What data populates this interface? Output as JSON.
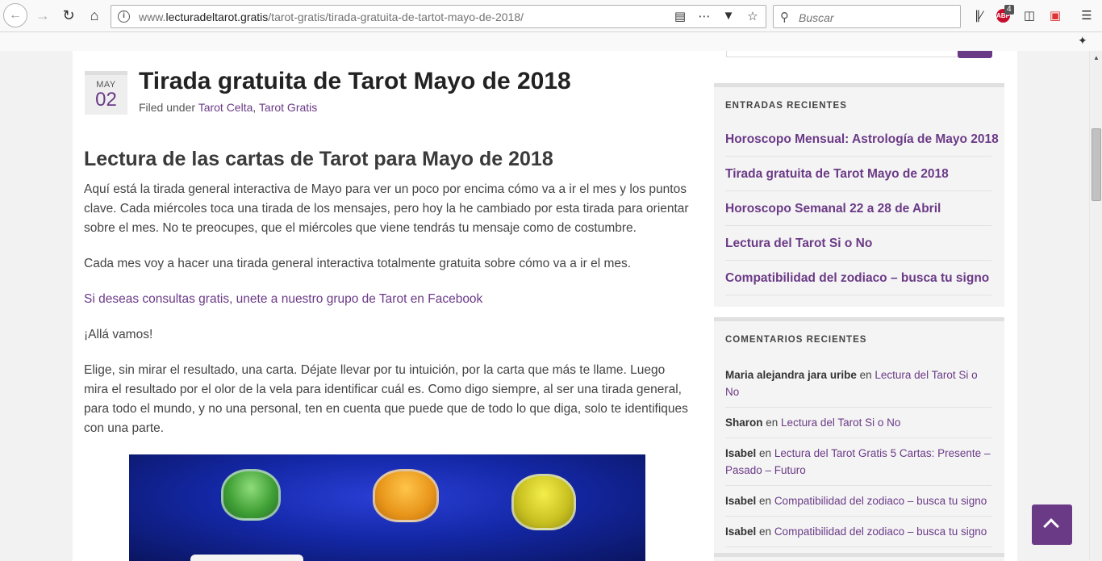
{
  "browser": {
    "url_host": "www.lecturadeltarot.gratis",
    "url_path": "/tarot-gratis/tirada-gratuita-de-tartot-mayo-de-2018/",
    "url_prefix": "www.",
    "url_domain": "lecturadeltarot.gratis",
    "search_placeholder": "Buscar",
    "abp_label": "ABP",
    "abp_count": "4"
  },
  "post": {
    "date_month": "MAY",
    "date_day": "02",
    "title": "Tirada gratuita de Tarot Mayo de 2018",
    "filed_prefix": "Filed under ",
    "categories": [
      "Tarot Celta",
      "Tarot Gratis"
    ],
    "category_separator": ", ",
    "subheading": "Lectura de las cartas de Tarot para Mayo de 2018",
    "paragraphs": [
      "Aquí está la tirada general interactiva de Mayo para ver un poco por encima cómo va a ir el mes y los puntos clave. Cada miércoles toca una tirada de los mensajes, pero hoy la he cambiado por esta tirada para orientar sobre el mes. No te preocupes, que el miércoles que viene tendrás tu mensaje como de costumbre.",
      "Cada mes voy a hacer una tirada general interactiva totalmente gratuita sobre cómo va a ir el mes.",
      "Si deseas consultas gratis, unete a nuestro grupo de Tarot en Facebook",
      "¡Allá vamos!",
      "Elige, sin mirar el resultado, una carta. Déjate llevar por tu intuición, por la carta que más te llame. Luego mira el resultado por el olor de la vela para identificar cuál es. Como digo siempre, al ser una tirada general, para todo el mundo, y no una personal, ten en cuenta que puede que de todo lo que diga, solo te identifiques con una parte."
    ]
  },
  "sidebar": {
    "recent_title": "ENTRADAS RECIENTES",
    "recent_posts": [
      "Horoscopo Mensual: Astrología de Mayo 2018",
      "Tirada gratuita de Tarot Mayo de 2018",
      "Horoscopo Semanal 22 a 28 de Abril",
      "Lectura del Tarot Si o No",
      "Compatibilidad del zodiaco – busca tu signo"
    ],
    "comments_title": "COMENTARIOS RECIENTES",
    "comment_joiner": " en ",
    "comments": [
      {
        "author": "Maria alejandra jara uribe",
        "post": "Lectura del Tarot Si o No"
      },
      {
        "author": "Sharon",
        "post": "Lectura del Tarot Si o No"
      },
      {
        "author": "Isabel",
        "post": "Lectura del Tarot Gratis 5 Cartas: Presente – Pasado – Futuro"
      },
      {
        "author": "Isabel",
        "post": "Compatibilidad del zodiaco – busca tu signo"
      },
      {
        "author": "Isabel",
        "post": "Compatibilidad del zodiaco – busca tu signo"
      }
    ]
  },
  "colors": {
    "accent": "#6b3a87",
    "text": "#444444"
  },
  "icons": [
    "back-icon",
    "forward-icon",
    "reload-icon",
    "home-icon",
    "info-icon",
    "reader-view-icon",
    "page-actions-icon",
    "pocket-icon",
    "bookmark-star-icon",
    "search-icon",
    "library-icon",
    "adblock-icon",
    "sidebar-icon",
    "screenshot-icon",
    "menu-icon",
    "pin-icon",
    "back-to-top-icon"
  ]
}
